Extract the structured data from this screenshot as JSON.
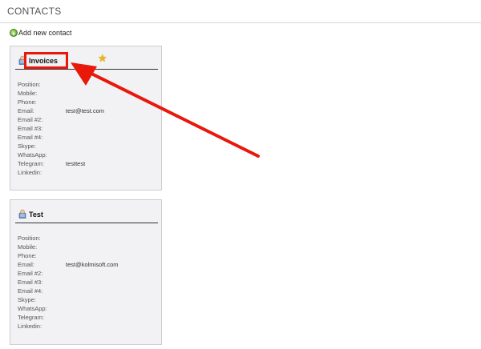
{
  "header": {
    "title": "CONTACTS"
  },
  "actions": {
    "add_contact_label": "Add new contact"
  },
  "contacts": [
    {
      "name": "Invoices",
      "favorite": true,
      "fields": [
        {
          "label": "Position:",
          "value": ""
        },
        {
          "label": "Mobile:",
          "value": ""
        },
        {
          "label": "Phone:",
          "value": ""
        },
        {
          "label": "Email:",
          "value": "test@test.com"
        },
        {
          "label": "Email #2:",
          "value": ""
        },
        {
          "label": "Email #3:",
          "value": ""
        },
        {
          "label": "Email #4:",
          "value": ""
        },
        {
          "label": "Skype:",
          "value": ""
        },
        {
          "label": "WhatsApp:",
          "value": ""
        },
        {
          "label": "Telegram:",
          "value": "testtest"
        },
        {
          "label": "Linkedin:",
          "value": ""
        }
      ]
    },
    {
      "name": "Test",
      "favorite": false,
      "fields": [
        {
          "label": "Position:",
          "value": ""
        },
        {
          "label": "Mobile:",
          "value": ""
        },
        {
          "label": "Phone:",
          "value": ""
        },
        {
          "label": "Email:",
          "value": "test@kolmisoft.com"
        },
        {
          "label": "Email #2:",
          "value": ""
        },
        {
          "label": "Email #3:",
          "value": ""
        },
        {
          "label": "Email #4:",
          "value": ""
        },
        {
          "label": "Skype:",
          "value": ""
        },
        {
          "label": "WhatsApp:",
          "value": ""
        },
        {
          "label": "Telegram:",
          "value": ""
        },
        {
          "label": "Linkedin:",
          "value": ""
        }
      ]
    }
  ],
  "colors": {
    "annotation_red": "#e8180b",
    "star": "#f2b705",
    "card_bg": "#f2f2f5"
  },
  "icons": {
    "add": "plus-circle-green",
    "contact": "contact-card",
    "favorite": "star"
  }
}
